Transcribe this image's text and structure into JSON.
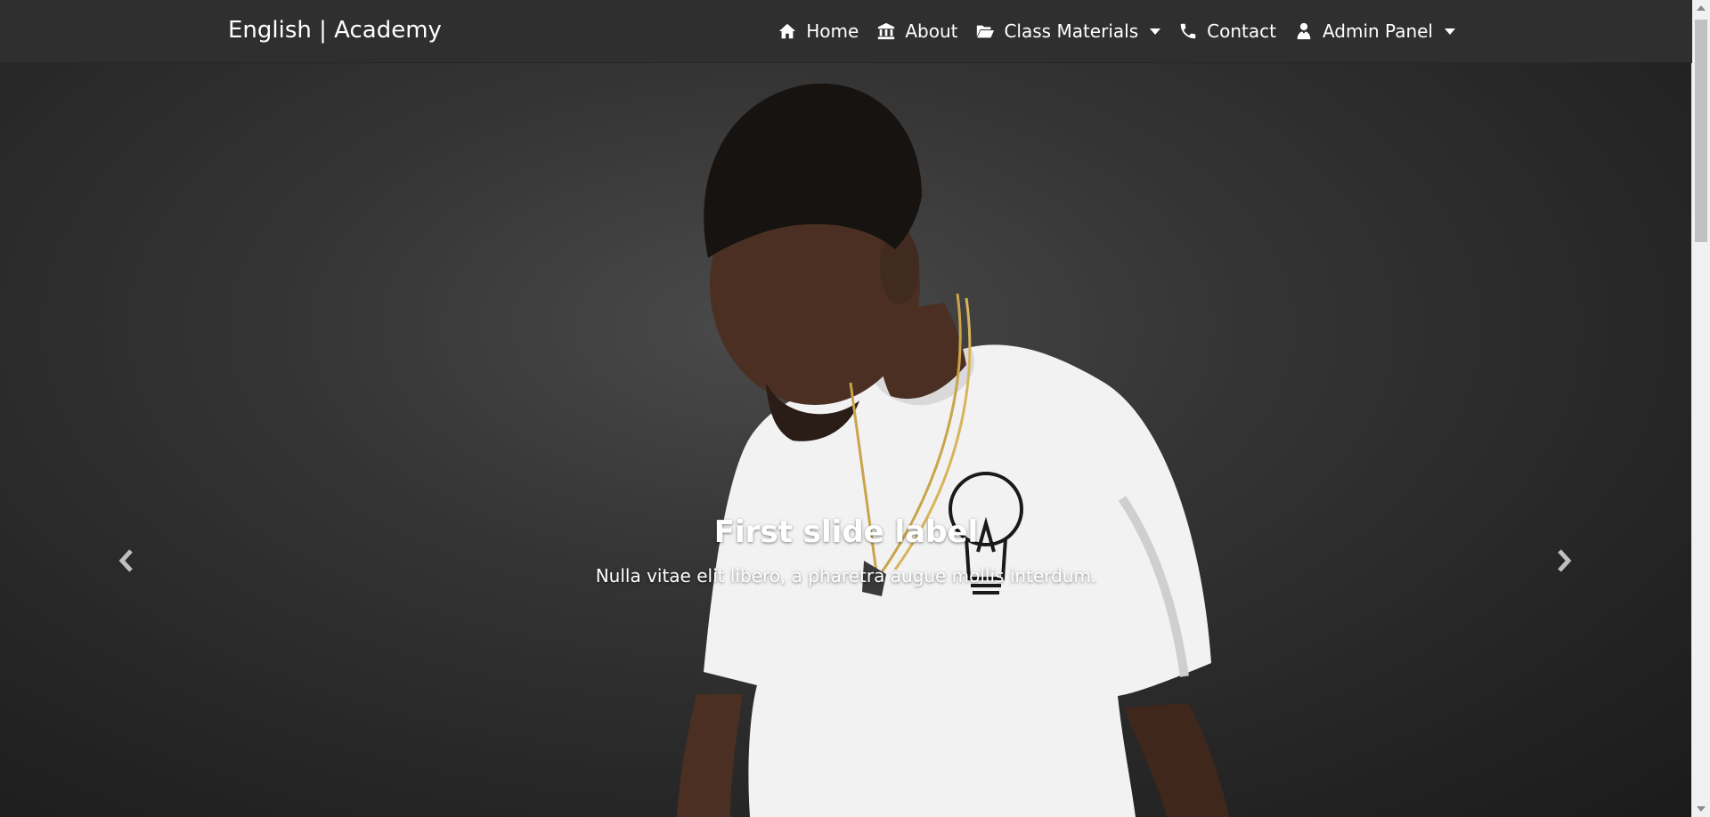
{
  "brand": "English | Academy",
  "nav": {
    "home": {
      "label": "Home",
      "icon": "home-icon"
    },
    "about": {
      "label": "About",
      "icon": "university-icon"
    },
    "class_materials": {
      "label": "Class Materials",
      "icon": "folder-open-icon",
      "dropdown": true
    },
    "contact": {
      "label": "Contact",
      "icon": "phone-icon"
    },
    "admin_panel": {
      "label": "Admin Panel",
      "icon": "user-tie-icon",
      "dropdown": true
    }
  },
  "carousel": {
    "slide_title": "First slide label",
    "slide_text": "Nulla vitae elit libero, a pharetra augue mollis interdum.",
    "prev_icon": "chevron-left-icon",
    "next_icon": "chevron-right-icon"
  },
  "colors": {
    "navbar_bg": "#2f2f2f",
    "text": "#ffffff",
    "hero_bg": "#2a2a2a"
  }
}
